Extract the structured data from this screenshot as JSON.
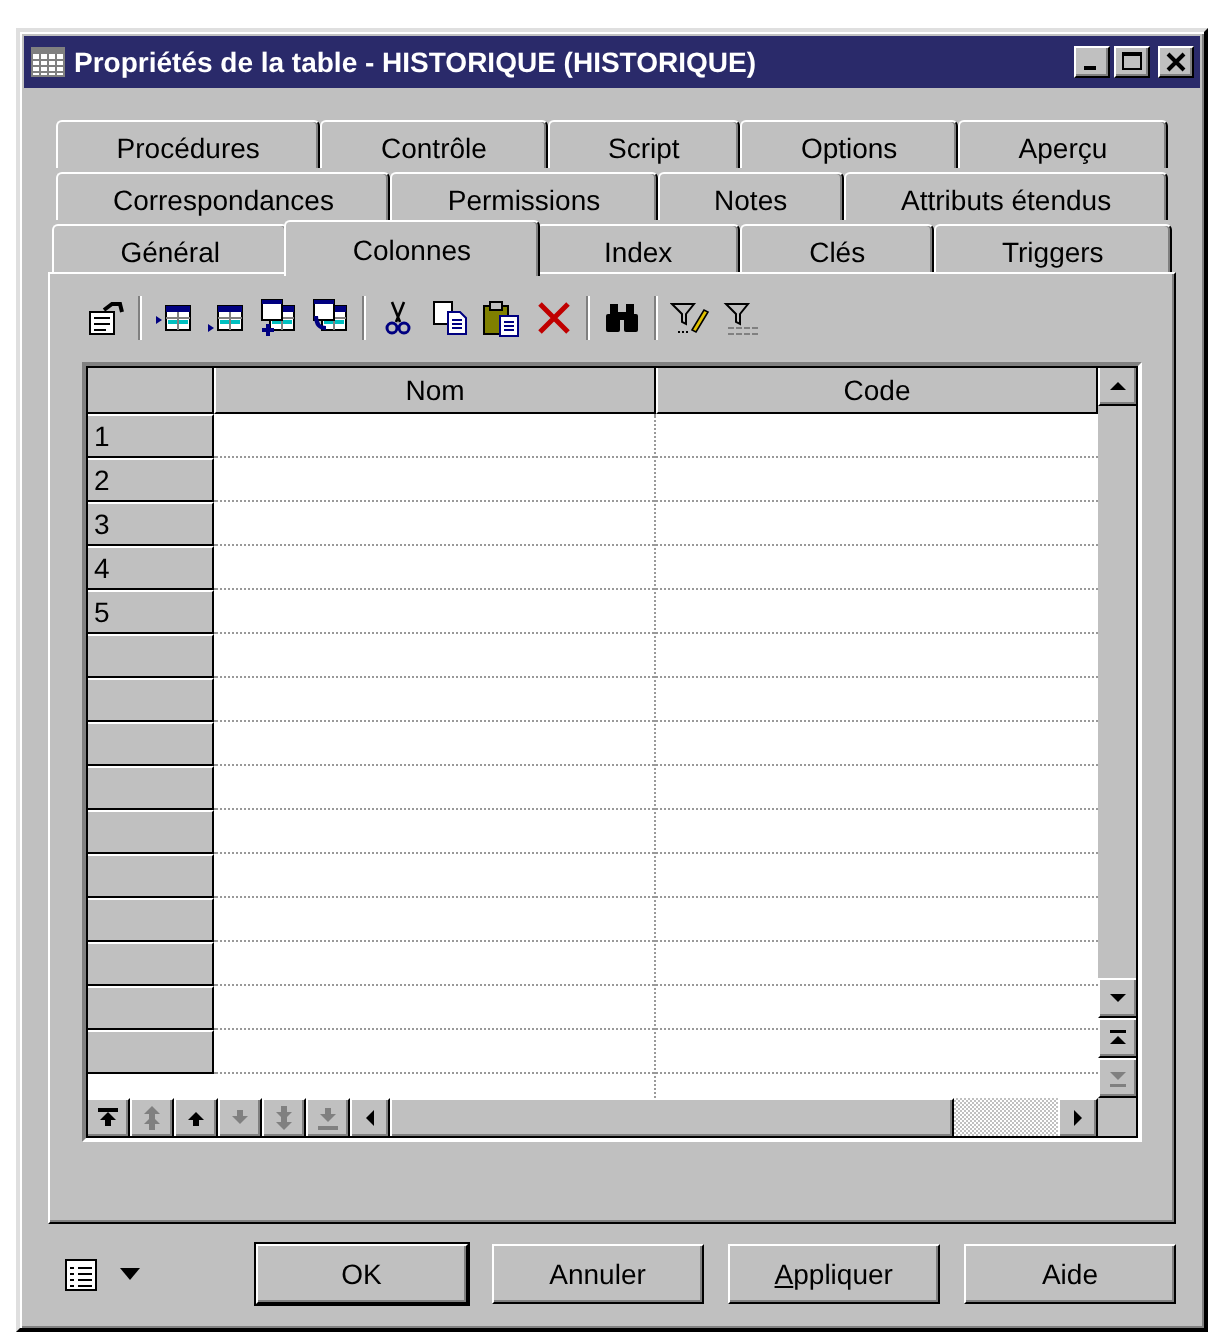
{
  "window": {
    "title": "Propriétés de la table - HISTORIQUE (HISTORIQUE)"
  },
  "tab_rows": [
    [
      {
        "label": "Procédures",
        "selected": false
      },
      {
        "label": "Contrôle",
        "selected": false
      },
      {
        "label": "Script",
        "selected": false
      },
      {
        "label": "Options",
        "selected": false
      },
      {
        "label": "Aperçu",
        "selected": false
      }
    ],
    [
      {
        "label": "Correspondances",
        "selected": false
      },
      {
        "label": "Permissions",
        "selected": false
      },
      {
        "label": "Notes",
        "selected": false
      },
      {
        "label": "Attributs étendus",
        "selected": false
      }
    ],
    [
      {
        "label": "Général",
        "selected": false
      },
      {
        "label": "Colonnes",
        "selected": true
      },
      {
        "label": "Index",
        "selected": false
      },
      {
        "label": "Clés",
        "selected": false
      },
      {
        "label": "Triggers",
        "selected": false
      }
    ]
  ],
  "grid": {
    "columns": [
      "Nom",
      "Code"
    ],
    "row_numbers": [
      "1",
      "2",
      "3",
      "4",
      "5"
    ],
    "nav_buttons": [
      {
        "kind": "first",
        "disabled": false
      },
      {
        "kind": "page-up",
        "disabled": true
      },
      {
        "kind": "up",
        "disabled": false
      },
      {
        "kind": "down",
        "disabled": true
      },
      {
        "kind": "page-down",
        "disabled": true
      },
      {
        "kind": "last",
        "disabled": true
      }
    ]
  },
  "buttons": [
    {
      "label": "OK",
      "default": true,
      "mnemonic": false
    },
    {
      "label": "Annuler",
      "default": false,
      "mnemonic": false
    },
    {
      "label": "Appliquer",
      "default": false,
      "mnemonic": true
    },
    {
      "label": "Aide",
      "default": false,
      "mnemonic": false
    }
  ]
}
